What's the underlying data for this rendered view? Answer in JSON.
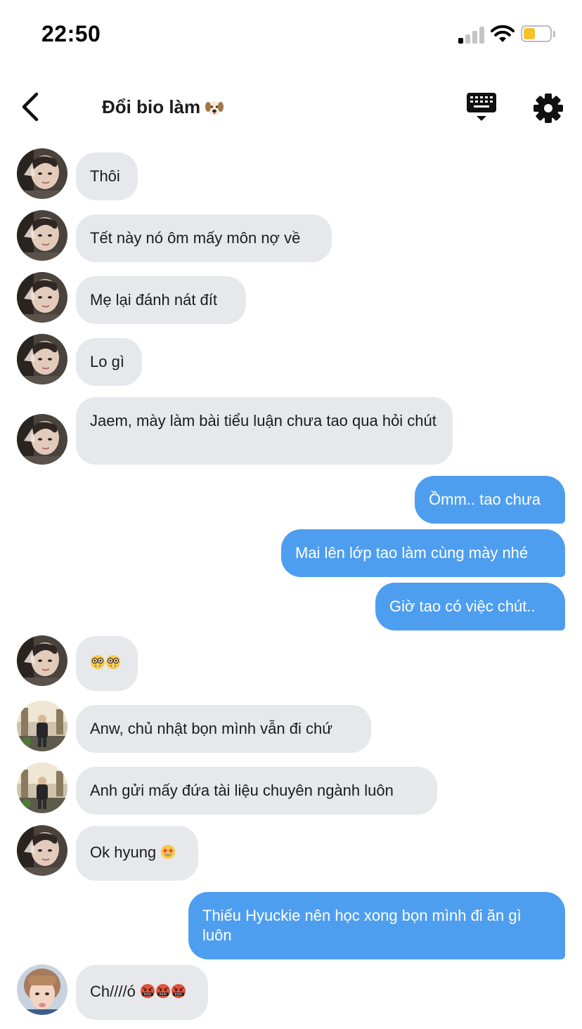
{
  "status_bar": {
    "time": "22:50",
    "signal_bars_active": 1,
    "battery_level": 0.45
  },
  "nav": {
    "title": "Đổi bio làm",
    "title_emoji": "dog-face"
  },
  "messages": [
    {
      "side": "in",
      "sender": "member-a",
      "text": "Thôi"
    },
    {
      "side": "in",
      "sender": "member-a",
      "text": "Tết này nó ôm mấy môn nợ về"
    },
    {
      "side": "in",
      "sender": "member-a",
      "text": "Mẹ lại đánh nát đít"
    },
    {
      "side": "in",
      "sender": "member-a",
      "text": "Lo gì"
    },
    {
      "side": "in",
      "sender": "member-a",
      "text": "Jaem, mày làm bài tiểu luận chưa tao qua hỏi chút"
    },
    {
      "side": "out",
      "text": "Ồmm.. tao chưa"
    },
    {
      "side": "out",
      "text": "Mai lên lớp tao làm cùng mày nhé"
    },
    {
      "side": "out",
      "text": "Giờ tao có việc chút.."
    },
    {
      "side": "in",
      "sender": "member-a",
      "text": "",
      "emojis": [
        "nerd-face",
        "nerd-face"
      ]
    },
    {
      "side": "in",
      "sender": "member-b",
      "text": "Anw, chủ nhật bọn mình vẫn đi chứ"
    },
    {
      "side": "in",
      "sender": "member-b",
      "text": "Anh gửi mấy đứa tài liệu chuyên ngành luôn"
    },
    {
      "side": "in",
      "sender": "member-a",
      "text": "Ok hyung",
      "emojis": [
        "star-struck"
      ]
    },
    {
      "side": "out",
      "text": "Thiếu Hyuckie nên học xong bọn mình đi ăn gì luôn"
    },
    {
      "side": "in",
      "sender": "member-c",
      "text": "Ch////ó",
      "emojis": [
        "cursing-face",
        "cursing-face",
        "cursing-face"
      ]
    }
  ],
  "colors": {
    "incoming_bubble": "#e7e8ec",
    "outgoing_bubble": "#4e9ef0",
    "battery": "#f5c22c"
  }
}
